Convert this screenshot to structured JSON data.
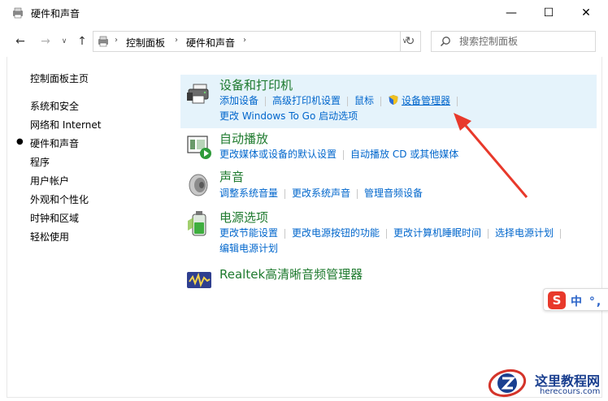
{
  "window": {
    "title": "硬件和声音",
    "minimize_glyph": "—",
    "maximize_glyph": "☐",
    "close_glyph": "✕"
  },
  "nav": {
    "back_glyph": "←",
    "forward_glyph": "→",
    "recent_glyph": "∨",
    "up_glyph": "↑",
    "breadcrumb": [
      "控制面板",
      "硬件和声音"
    ],
    "separator_glyph": "›",
    "dropdown_glyph": "∨",
    "refresh_glyph": "↻",
    "search_placeholder": "搜索控制面板"
  },
  "sidebar": {
    "bullet": "●",
    "items": [
      {
        "label": "控制面板主页",
        "active": false
      },
      {
        "label": "系统和安全",
        "active": false
      },
      {
        "label": "网络和 Internet",
        "active": false
      },
      {
        "label": "硬件和声音",
        "active": true
      },
      {
        "label": "程序",
        "active": false
      },
      {
        "label": "用户帐户",
        "active": false
      },
      {
        "label": "外观和个性化",
        "active": false
      },
      {
        "label": "时钟和区域",
        "active": false
      },
      {
        "label": "轻松使用",
        "active": false
      }
    ]
  },
  "categories": [
    {
      "title": "设备和打印机",
      "icon": "printer-icon",
      "highlighted": true,
      "links_row1": [
        "添加设备",
        "高级打印机设置",
        "鼠标",
        "设备管理器"
      ],
      "links_row2": [
        "更改 Windows To Go 启动选项"
      ]
    },
    {
      "title": "自动播放",
      "icon": "autoplay-icon",
      "links_row1": [
        "更改媒体或设备的默认设置",
        "自动播放 CD 或其他媒体"
      ]
    },
    {
      "title": "声音",
      "icon": "speaker-icon",
      "links_row1": [
        "调整系统音量",
        "更改系统声音",
        "管理音频设备"
      ]
    },
    {
      "title": "电源选项",
      "icon": "battery-icon",
      "links_row1": [
        "更改节能设置",
        "更改电源按钮的功能",
        "更改计算机睡眠时间",
        "选择电源计划"
      ],
      "links_row2": [
        "编辑电源计划"
      ]
    },
    {
      "title": "Realtek高清晰音频管理器",
      "icon": "realtek-audio-icon",
      "links_row1": []
    }
  ],
  "ime": {
    "logo": "S",
    "text": "中 °,"
  },
  "watermark": {
    "title": "这里教程网",
    "url": "herecours.com"
  },
  "colors": {
    "link": "#0066cc",
    "category_title": "#1e7a2e",
    "highlight_bg": "#e5f3fb",
    "arrow": "#e8392b"
  }
}
